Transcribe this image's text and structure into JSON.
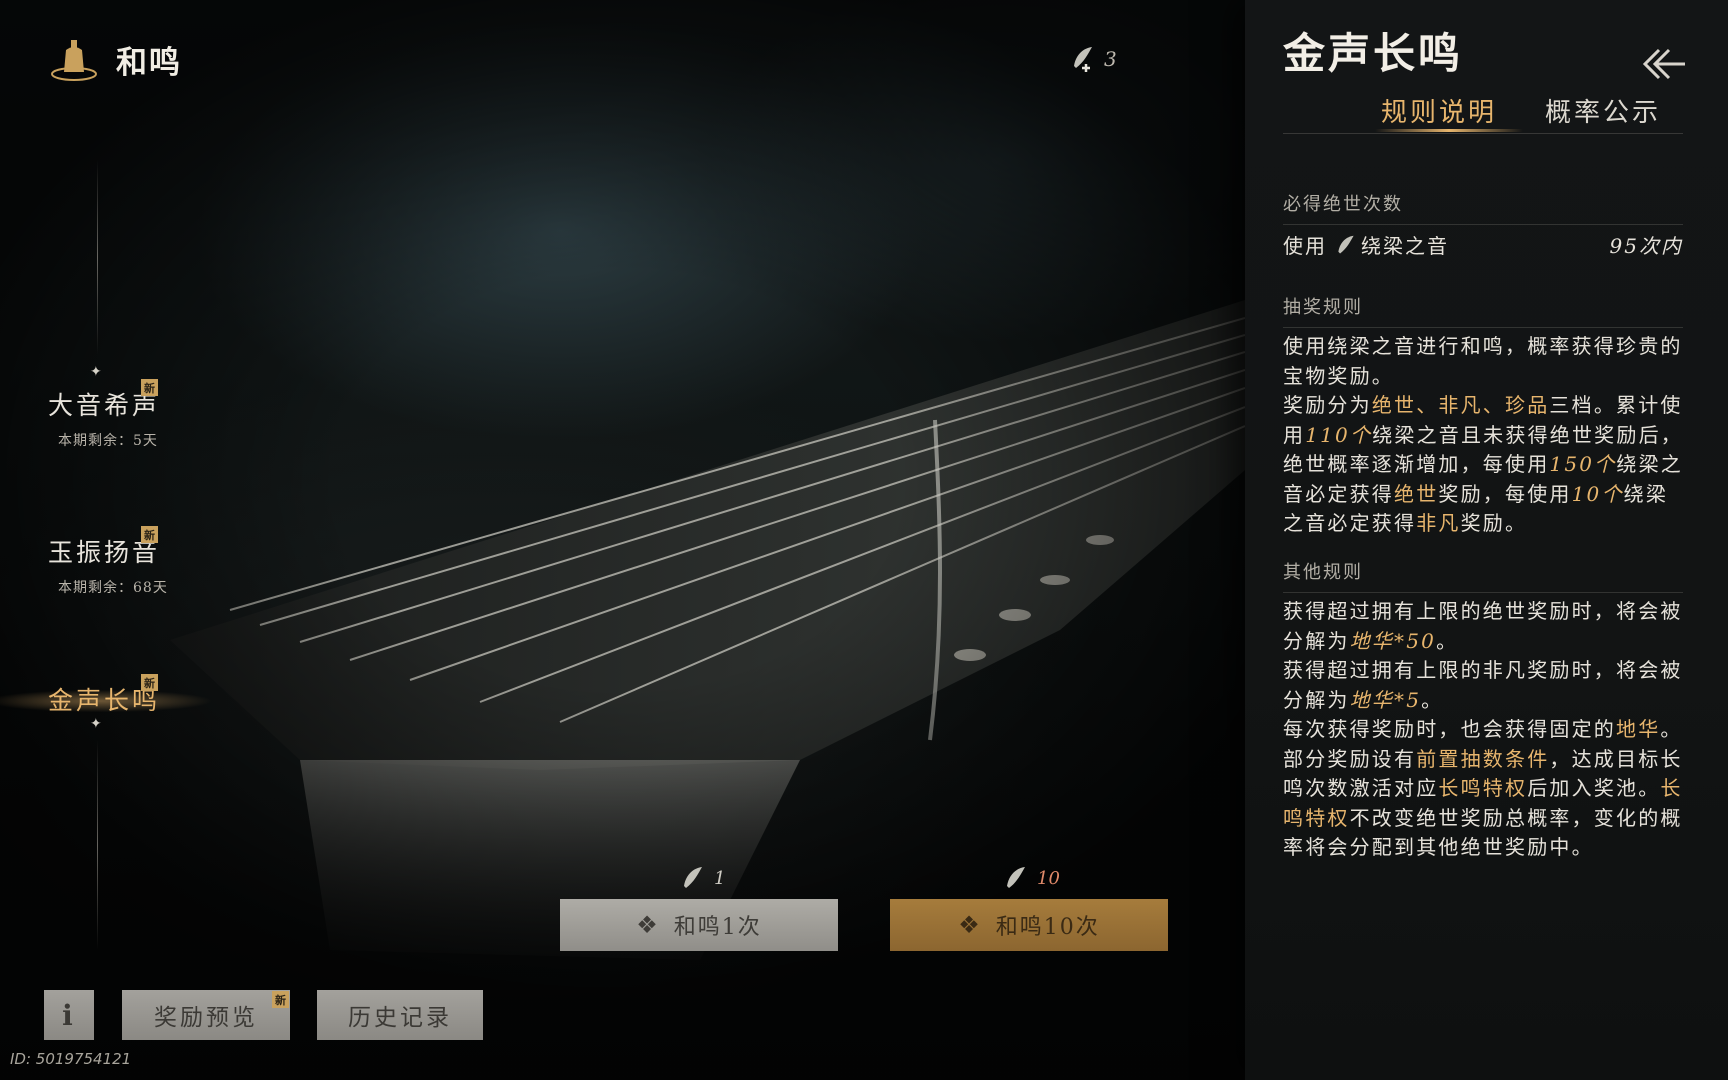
{
  "header": {
    "title": "和鸣"
  },
  "currency": {
    "count": "3"
  },
  "nav": [
    {
      "name": "大音希声",
      "sub": "本期剩余：5天",
      "badge": "新"
    },
    {
      "name": "玉振扬音",
      "sub": "本期剩余：68天",
      "badge": "新"
    },
    {
      "name": "金声长鸣",
      "badge": "新",
      "active": true
    }
  ],
  "draw": {
    "single": {
      "cost": "1",
      "label": "和鸣1次"
    },
    "multi": {
      "cost": "10",
      "label": "和鸣10次"
    }
  },
  "bottom": {
    "info_label": "i",
    "reward_label": "奖励预览",
    "reward_badge": "新",
    "history_label": "历史记录"
  },
  "user_id": "ID: 5019754121",
  "panel": {
    "title": "金声长鸣",
    "tabs": [
      "规则说明",
      "概率公示"
    ],
    "guarantee": {
      "heading": "必得绝世次数",
      "use": "使用",
      "item": "绕梁之音",
      "value": "95次内"
    },
    "draw_rules": {
      "heading": "抽奖规则",
      "p1": "使用绕梁之音进行和鸣，概率获得珍贵的宝物奖励。",
      "p2": {
        "t1": "奖励分为",
        "h1": "绝世、非凡、珍品",
        "t2": "三档。累计使用",
        "h2": "110个",
        "t3": "绕梁之音且未获得绝世奖励后，绝世概率逐渐增加，每使用",
        "h3": "150个",
        "t4": "绕梁之音必定获得",
        "h4": "绝世",
        "t5": "奖励，每使用",
        "h5": "10个",
        "t6": "绕梁之音必定获得",
        "h6": "非凡",
        "t7": "奖励。"
      }
    },
    "other_rules": {
      "heading": "其他规则",
      "p1": {
        "t1": "获得超过拥有上限的绝世奖励时，将会被分解为",
        "h1": "地华*50",
        "t2": "。"
      },
      "p2": {
        "t1": "获得超过拥有上限的非凡奖励时，将会被分解为",
        "h1": "地华*5",
        "t2": "。"
      },
      "p3": {
        "t1": "每次获得奖励时，也会获得固定的",
        "h1": "地华",
        "t2": "。"
      },
      "p4": {
        "t1": "部分奖励设有",
        "h1": "前置抽数条件",
        "t2": "，达成目标长鸣次数激活对应",
        "h2": "长鸣特权",
        "t3": "后加入奖池。",
        "h3": "长鸣特权",
        "t4": "不改变绝世奖励总概率，变化的概率将会分配到其他绝世奖励中。"
      }
    }
  },
  "colors": {
    "accent": "#e7b56d",
    "panel_bg": "#131516",
    "button_grey": "#a3a19c",
    "button_gold": "#a67c3c"
  }
}
